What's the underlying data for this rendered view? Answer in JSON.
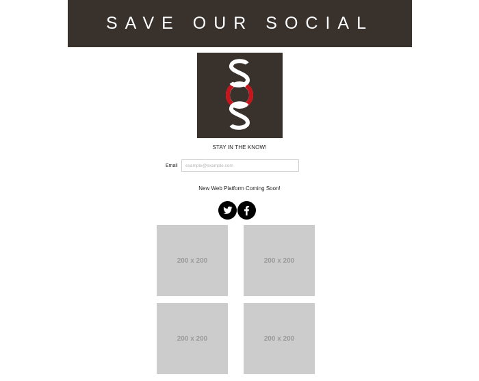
{
  "banner": {
    "title": "SAVE OUR SOCIAL"
  },
  "logo": {
    "letters": "SOS",
    "caption": "SAVE OUR SOCIAL"
  },
  "signup": {
    "heading": "STAY IN THE KNOW!",
    "email_label": "Email",
    "email_placeholder": "example@example.com",
    "email_value": ""
  },
  "announcement": "New Web Platform Coming Soon!",
  "social": [
    {
      "name": "twitter",
      "icon": "twitter-icon"
    },
    {
      "name": "facebook",
      "icon": "facebook-icon"
    }
  ],
  "gallery": [
    {
      "label": "200 x 200"
    },
    {
      "label": "200 x 200"
    },
    {
      "label": "200 x 200"
    },
    {
      "label": "200 x 200"
    }
  ],
  "colors": {
    "brand_dark": "#38312c",
    "accent_red": "#c4161c",
    "placeholder_gray": "#cccccc"
  }
}
